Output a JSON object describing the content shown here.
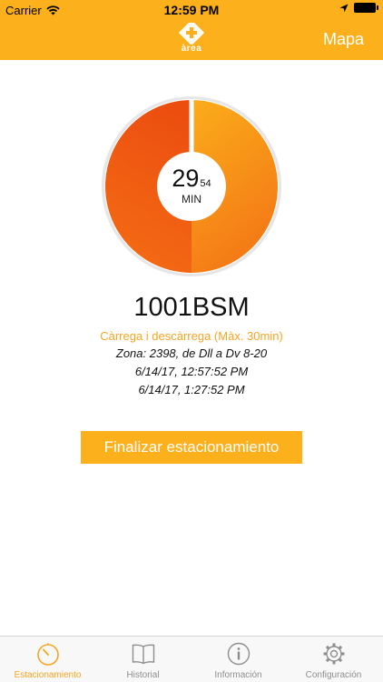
{
  "status_bar": {
    "carrier": "Carrier",
    "time": "12:59 PM"
  },
  "nav": {
    "logo_text": "àrea",
    "right_label": "Mapa"
  },
  "timer": {
    "minutes": "29",
    "seconds": "54",
    "unit": "MIN",
    "remaining_fraction": 0.998
  },
  "parking": {
    "plate": "1001BSM",
    "tariff": "Càrrega i descàrrega (Màx. 30min)",
    "zone": "Zona: 2398, de Dll a Dv 8-20",
    "start": "6/14/17, 12:57:52 PM",
    "end": "6/14/17, 1:27:52 PM"
  },
  "finish_button": "Finalizar estacionamiento",
  "tabs": [
    {
      "label": "Estacionamiento",
      "icon": "timer-icon",
      "active": true
    },
    {
      "label": "Historial",
      "icon": "book-icon",
      "active": false
    },
    {
      "label": "Información",
      "icon": "info-icon",
      "active": false
    },
    {
      "label": "Configuración",
      "icon": "gear-icon",
      "active": false
    }
  ],
  "colors": {
    "accent": "#fbb01c",
    "donut_start": "#f6a31e",
    "donut_end": "#ee4e10"
  }
}
